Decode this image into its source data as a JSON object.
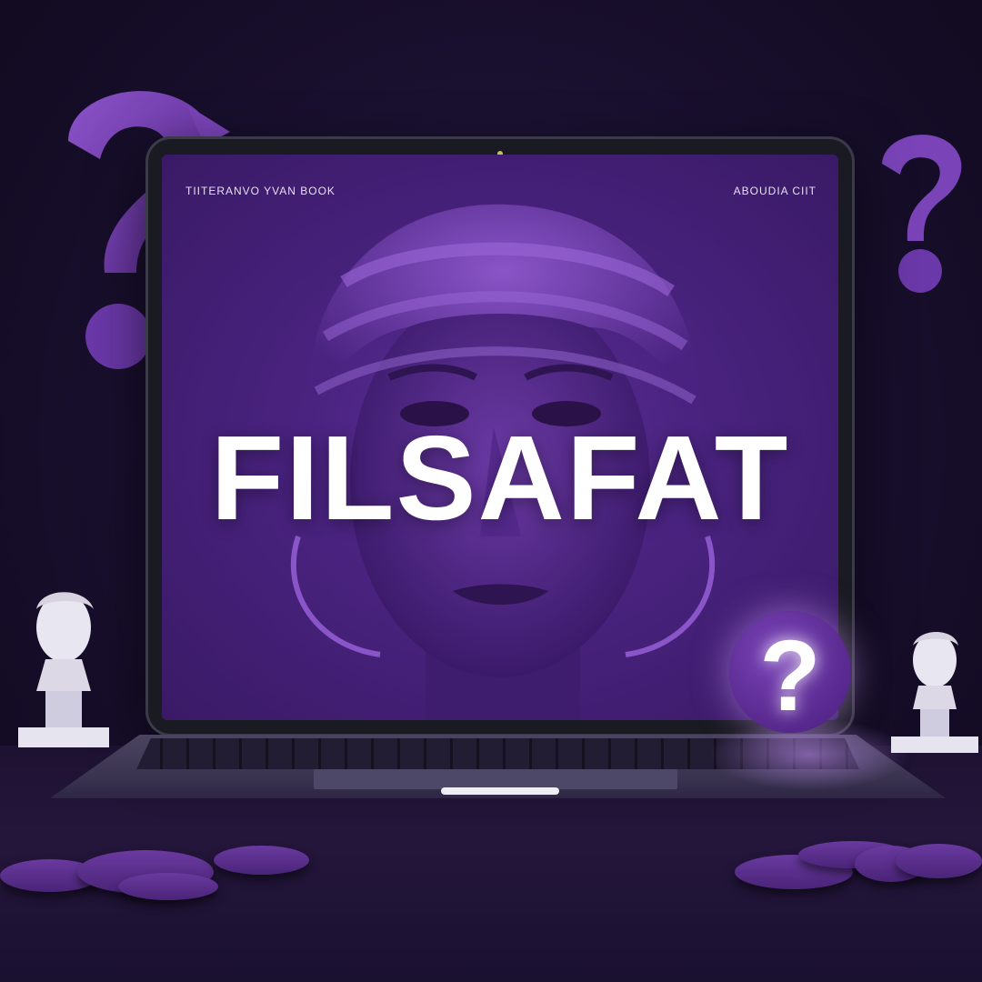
{
  "screen": {
    "nav_left": "TIITERANVO YVAN BOOK",
    "nav_right": "ABOUDIA CIIT",
    "title": "FILSAFAT"
  },
  "decor": {
    "accent_color": "#5e2f95",
    "question_mark_glyph": "?",
    "icons": [
      "question-mark-icon",
      "bust-statue-icon",
      "laptop-icon"
    ]
  }
}
